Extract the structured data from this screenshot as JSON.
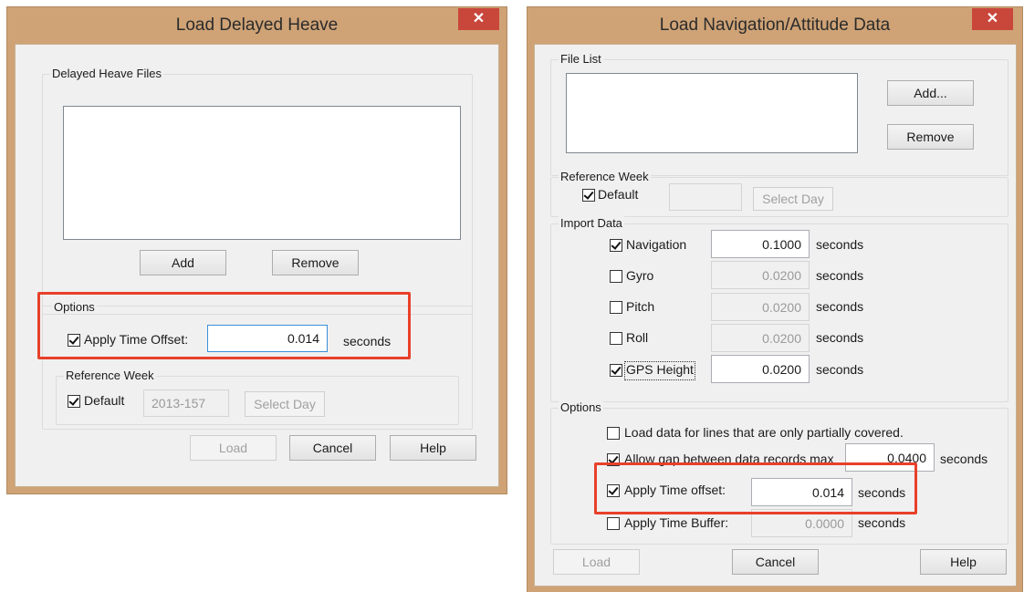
{
  "left_dialog": {
    "title": "Load Delayed Heave",
    "close_glyph": "✕",
    "files_group": {
      "label": "Delayed Heave Files",
      "add": "Add",
      "remove": "Remove"
    },
    "options_group": {
      "label": "Options",
      "apply_time_offset": {
        "label": "Apply Time Offset:",
        "checked": true,
        "value": "0.014",
        "unit": "seconds"
      }
    },
    "ref_week_group": {
      "label": "Reference Week",
      "default": {
        "label": "Default",
        "checked": true
      },
      "value": "2013-157",
      "select_day": "Select Day"
    },
    "buttons": {
      "load": "Load",
      "cancel": "Cancel",
      "help": "Help"
    }
  },
  "right_dialog": {
    "title": "Load Navigation/Attitude Data",
    "close_glyph": "✕",
    "file_list_group": {
      "label": "File List",
      "add": "Add...",
      "remove": "Remove"
    },
    "ref_week_group": {
      "label": "Reference Week",
      "default": {
        "label": "Default",
        "checked": true
      },
      "value": "",
      "select_day": "Select Day"
    },
    "import_group": {
      "label": "Import Data",
      "rows": [
        {
          "label": "Navigation",
          "checked": true,
          "value": "0.1000",
          "unit": "seconds",
          "enabled": true
        },
        {
          "label": "Gyro",
          "checked": false,
          "value": "0.0200",
          "unit": "seconds",
          "enabled": false
        },
        {
          "label": "Pitch",
          "checked": false,
          "value": "0.0200",
          "unit": "seconds",
          "enabled": false
        },
        {
          "label": "Roll",
          "checked": false,
          "value": "0.0200",
          "unit": "seconds",
          "enabled": false
        },
        {
          "label": "GPS Height",
          "checked": true,
          "value": "0.0200",
          "unit": "seconds",
          "enabled": true
        }
      ]
    },
    "options_group": {
      "label": "Options",
      "partial": {
        "label": "Load data for lines that are only partially covered.",
        "checked": false
      },
      "gap": {
        "label": "Allow gap between data records max",
        "checked": true,
        "value": "0.0400",
        "unit": "seconds"
      },
      "offset": {
        "label": "Apply Time offset:",
        "checked": true,
        "value": "0.014",
        "unit": "seconds"
      },
      "buffer": {
        "label": "Apply Time Buffer:",
        "checked": false,
        "value": "0.0000",
        "unit": "seconds"
      }
    },
    "buttons": {
      "load": "Load",
      "cancel": "Cancel",
      "help": "Help"
    }
  },
  "colors": {
    "highlight": "#e8402a",
    "title_bar": "#cfa376",
    "close": "#c9463b"
  }
}
